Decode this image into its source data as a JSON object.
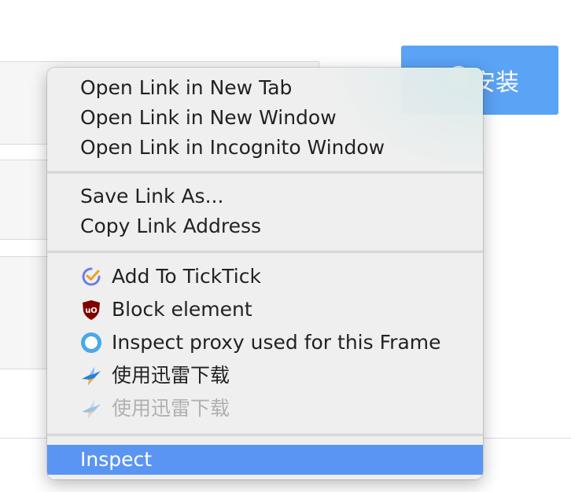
{
  "background": {
    "install_button_label": "安装"
  },
  "menu": {
    "group1": [
      "Open Link in New Tab",
      "Open Link in New Window",
      "Open Link in Incognito Window"
    ],
    "group2": [
      "Save Link As...",
      "Copy Link Address"
    ],
    "group3": [
      {
        "label": "Add To TickTick",
        "icon": "ticktick-icon"
      },
      {
        "label": "Block element",
        "icon": "ublock-icon"
      },
      {
        "label": "Inspect proxy used for this Frame",
        "icon": "proxy-ring-icon"
      },
      {
        "label": "使用迅雷下载",
        "icon": "thunder-bird-icon"
      },
      {
        "label": "使用迅雷下载",
        "icon": "thunder-bird-icon",
        "disabled": true
      }
    ],
    "group4": [
      {
        "label": "Inspect",
        "highlighted": true
      }
    ]
  },
  "colors": {
    "highlight": "#5b95f3",
    "install_button": "#5ba3f5",
    "ublock_red": "#800000",
    "proxy_ring": "#4aa8e8"
  }
}
